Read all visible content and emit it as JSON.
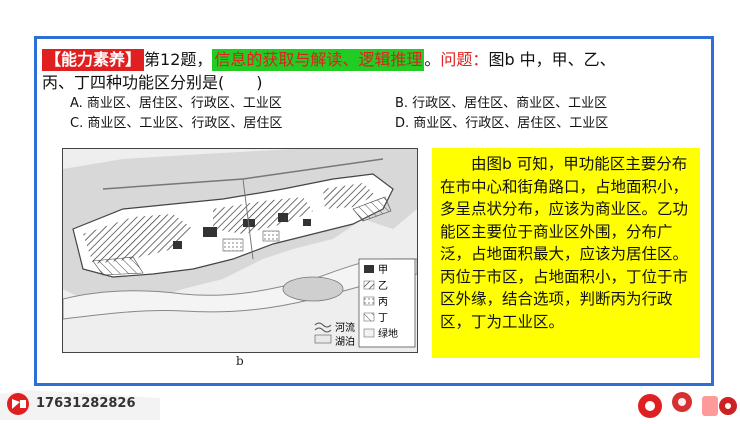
{
  "question": {
    "tag": "【能力素养】",
    "number": "第12题，",
    "skill": "信息的获取与解读、逻辑推理",
    "period": "。",
    "prompt_label": "问题：",
    "prompt_text": "图b 中，甲、乙、",
    "line2": "丙、丁四种功能区分别是(　　)"
  },
  "options": [
    {
      "label": "A. 商业区、居住区、行政区、工业区"
    },
    {
      "label": "B. 行政区、居住区、商业区、工业区"
    },
    {
      "label": "C. 商业区、工业区、行政区、居住区"
    },
    {
      "label": "D. 商业区、行政区、居住区、工业区"
    }
  ],
  "map": {
    "caption": "b",
    "legend": [
      {
        "label": "甲"
      },
      {
        "label": "乙"
      },
      {
        "label": "丙"
      },
      {
        "label": "丁"
      },
      {
        "label": "绿地"
      }
    ],
    "river_label_1": "河流",
    "river_label_2": "湖泊"
  },
  "answer": {
    "text": "由图b 可知，甲功能区主要分布在市中心和街角路口，占地面积小，多呈点状分布，应该为商业区。乙功能区主要位于商业区外围，分布广泛，占地面积最大，应该为居住区。丙位于市区，占地面积小，丁位于市区外缘，结合选项，判断丙为行政区，丁为工业区。"
  },
  "footer": {
    "phone": "17631282826"
  },
  "colors": {
    "frame": "#2e6fd6",
    "tag_bg": "#e02020",
    "highlight_bg": "#22cc22",
    "answer_bg": "#ffff00"
  }
}
